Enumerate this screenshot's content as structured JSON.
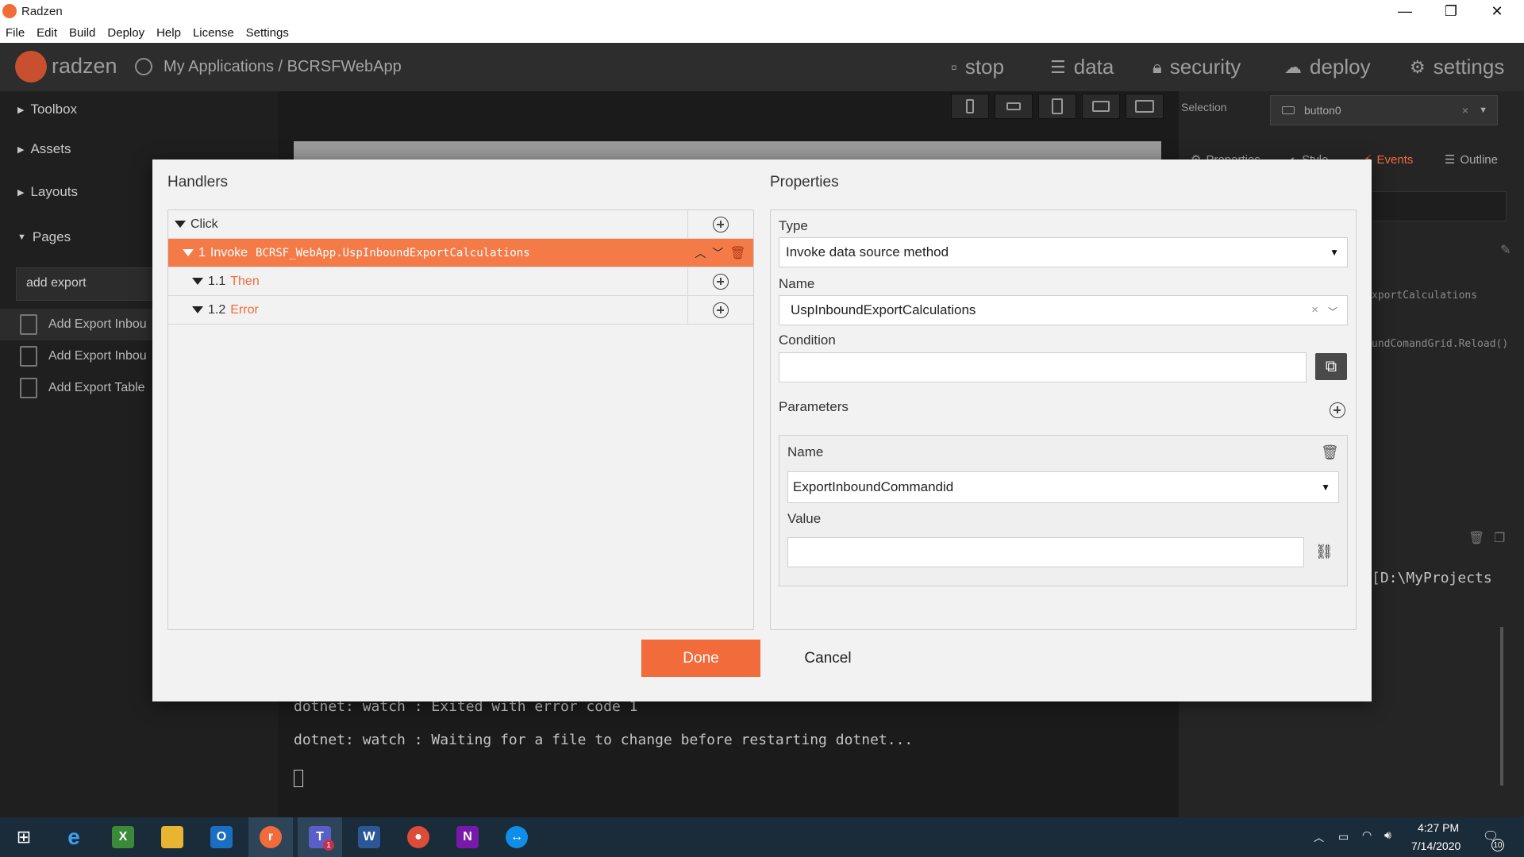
{
  "window": {
    "title": "Radzen",
    "minimize": "—",
    "restore": "❐",
    "close": "✕"
  },
  "menu": [
    "File",
    "Edit",
    "Build",
    "Deploy",
    "Help",
    "License",
    "Settings"
  ],
  "header": {
    "logo_text": "radzen",
    "breadcrumb": "My Applications / BCRSFWebApp",
    "nav": [
      {
        "label": "stop",
        "icon": "stop-icon"
      },
      {
        "label": "data",
        "icon": "layers-icon"
      },
      {
        "label": "security",
        "icon": "lock-icon"
      },
      {
        "label": "deploy",
        "icon": "cloud-upload-icon"
      },
      {
        "label": "settings",
        "icon": "gear-icon"
      }
    ]
  },
  "sidebar": {
    "sections": [
      "Toolbox",
      "Assets",
      "Layouts",
      "Pages"
    ],
    "search_value": "add export",
    "pages": [
      "Add Export Inbou",
      "Add Export Inbou",
      "Add Export Table"
    ]
  },
  "right_panel": {
    "selection_label": "Selection",
    "selection_value": "button0",
    "tabs": [
      "Properties",
      "Style",
      "Events",
      "Outline"
    ],
    "snippet1": "xportCalculations",
    "snippet2": "undComandGrid.Reload()",
    "console_snippet": "[D:\\MyProjects"
  },
  "console": {
    "line1": "dotnet: watch : Exited with error code 1",
    "line2": "dotnet: watch : Waiting for a file to change before restarting dotnet..."
  },
  "dialog": {
    "handlers_title": "Handlers",
    "properties_title": "Properties",
    "event_name": "Click",
    "handler": {
      "number": "1",
      "action": "Invoke",
      "target": "BCRSF_WebApp.UspInboundExportCalculations"
    },
    "then": {
      "number": "1.1",
      "label": "Then"
    },
    "error": {
      "number": "1.2",
      "label": "Error"
    },
    "type_label": "Type",
    "type_value": "Invoke data source method",
    "name_label": "Name",
    "name_value": "UspInboundExportCalculations",
    "condition_label": "Condition",
    "condition_value": "",
    "parameters_label": "Parameters",
    "param": {
      "name_label": "Name",
      "name_value": "ExportInboundCommandid",
      "value_label": "Value",
      "value_value": ""
    },
    "done_label": "Done",
    "cancel_label": "Cancel"
  },
  "taskbar": {
    "time": "4:27 PM",
    "date": "7/14/2020",
    "notifications": "10",
    "teams_badge": "1"
  },
  "colors": {
    "accent": "#f26b3a",
    "header_bg": "#2d2d2d",
    "taskbar_bg": "#1a2b39"
  }
}
